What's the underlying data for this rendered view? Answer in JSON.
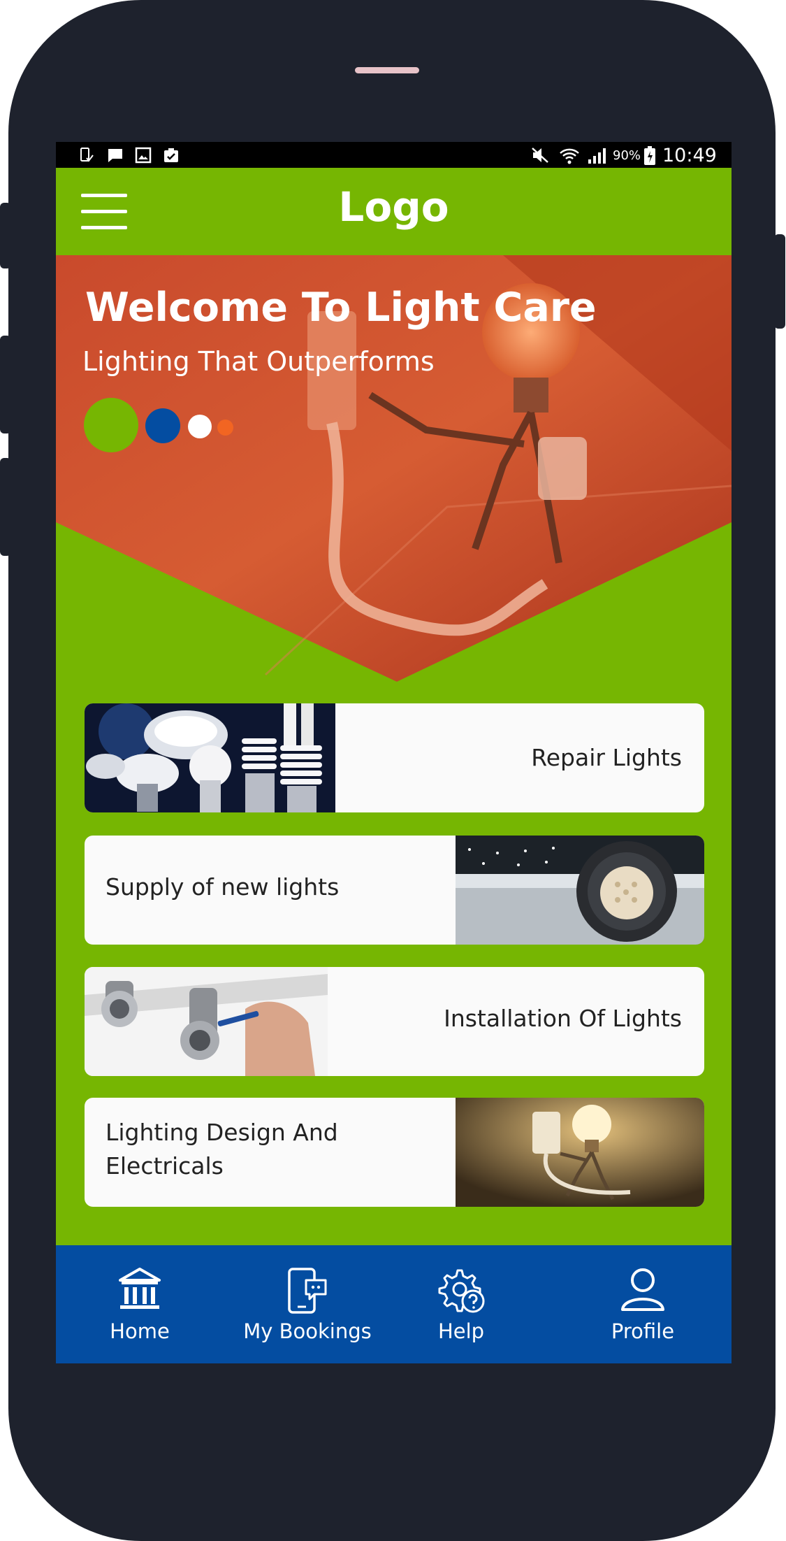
{
  "status_bar": {
    "battery_percent": "90%",
    "time": "10:49",
    "left_icons": [
      "screenshot-icon",
      "message-icon",
      "image-icon",
      "clipboard-check-icon"
    ],
    "right_icons": [
      "mute-icon",
      "wifi-icon",
      "signal-icon",
      "battery-icon"
    ]
  },
  "app_bar": {
    "logo_text": "Logo",
    "menu_icon": "hamburger-menu-icon"
  },
  "hero": {
    "title": "Welcome To Light Care",
    "subtitle": "Lighting That Outperforms",
    "carousel_dots": 4,
    "active_dot": 0
  },
  "services": [
    {
      "label": "Repair Lights",
      "image": "assorted-bulbs-image"
    },
    {
      "label": "Supply of new lights",
      "image": "warehouse-high-bay-light-image"
    },
    {
      "label": "Installation Of Lights",
      "image": "spotlight-installation-image"
    },
    {
      "label": "Lighting Design And Electricals",
      "image": "bulb-robot-image"
    }
  ],
  "bottom_nav": {
    "items": [
      {
        "label": "Home",
        "icon": "bank-icon"
      },
      {
        "label": "My Bookings",
        "icon": "phone-chat-icon"
      },
      {
        "label": "Help",
        "icon": "gear-question-icon"
      },
      {
        "label": "Profile",
        "icon": "user-icon"
      }
    ]
  },
  "colors": {
    "primary_green": "#76b602",
    "nav_blue": "#044da1",
    "hero_orange": "#d2542c",
    "accent_orange": "#f26522",
    "frame": "#1e222d"
  }
}
